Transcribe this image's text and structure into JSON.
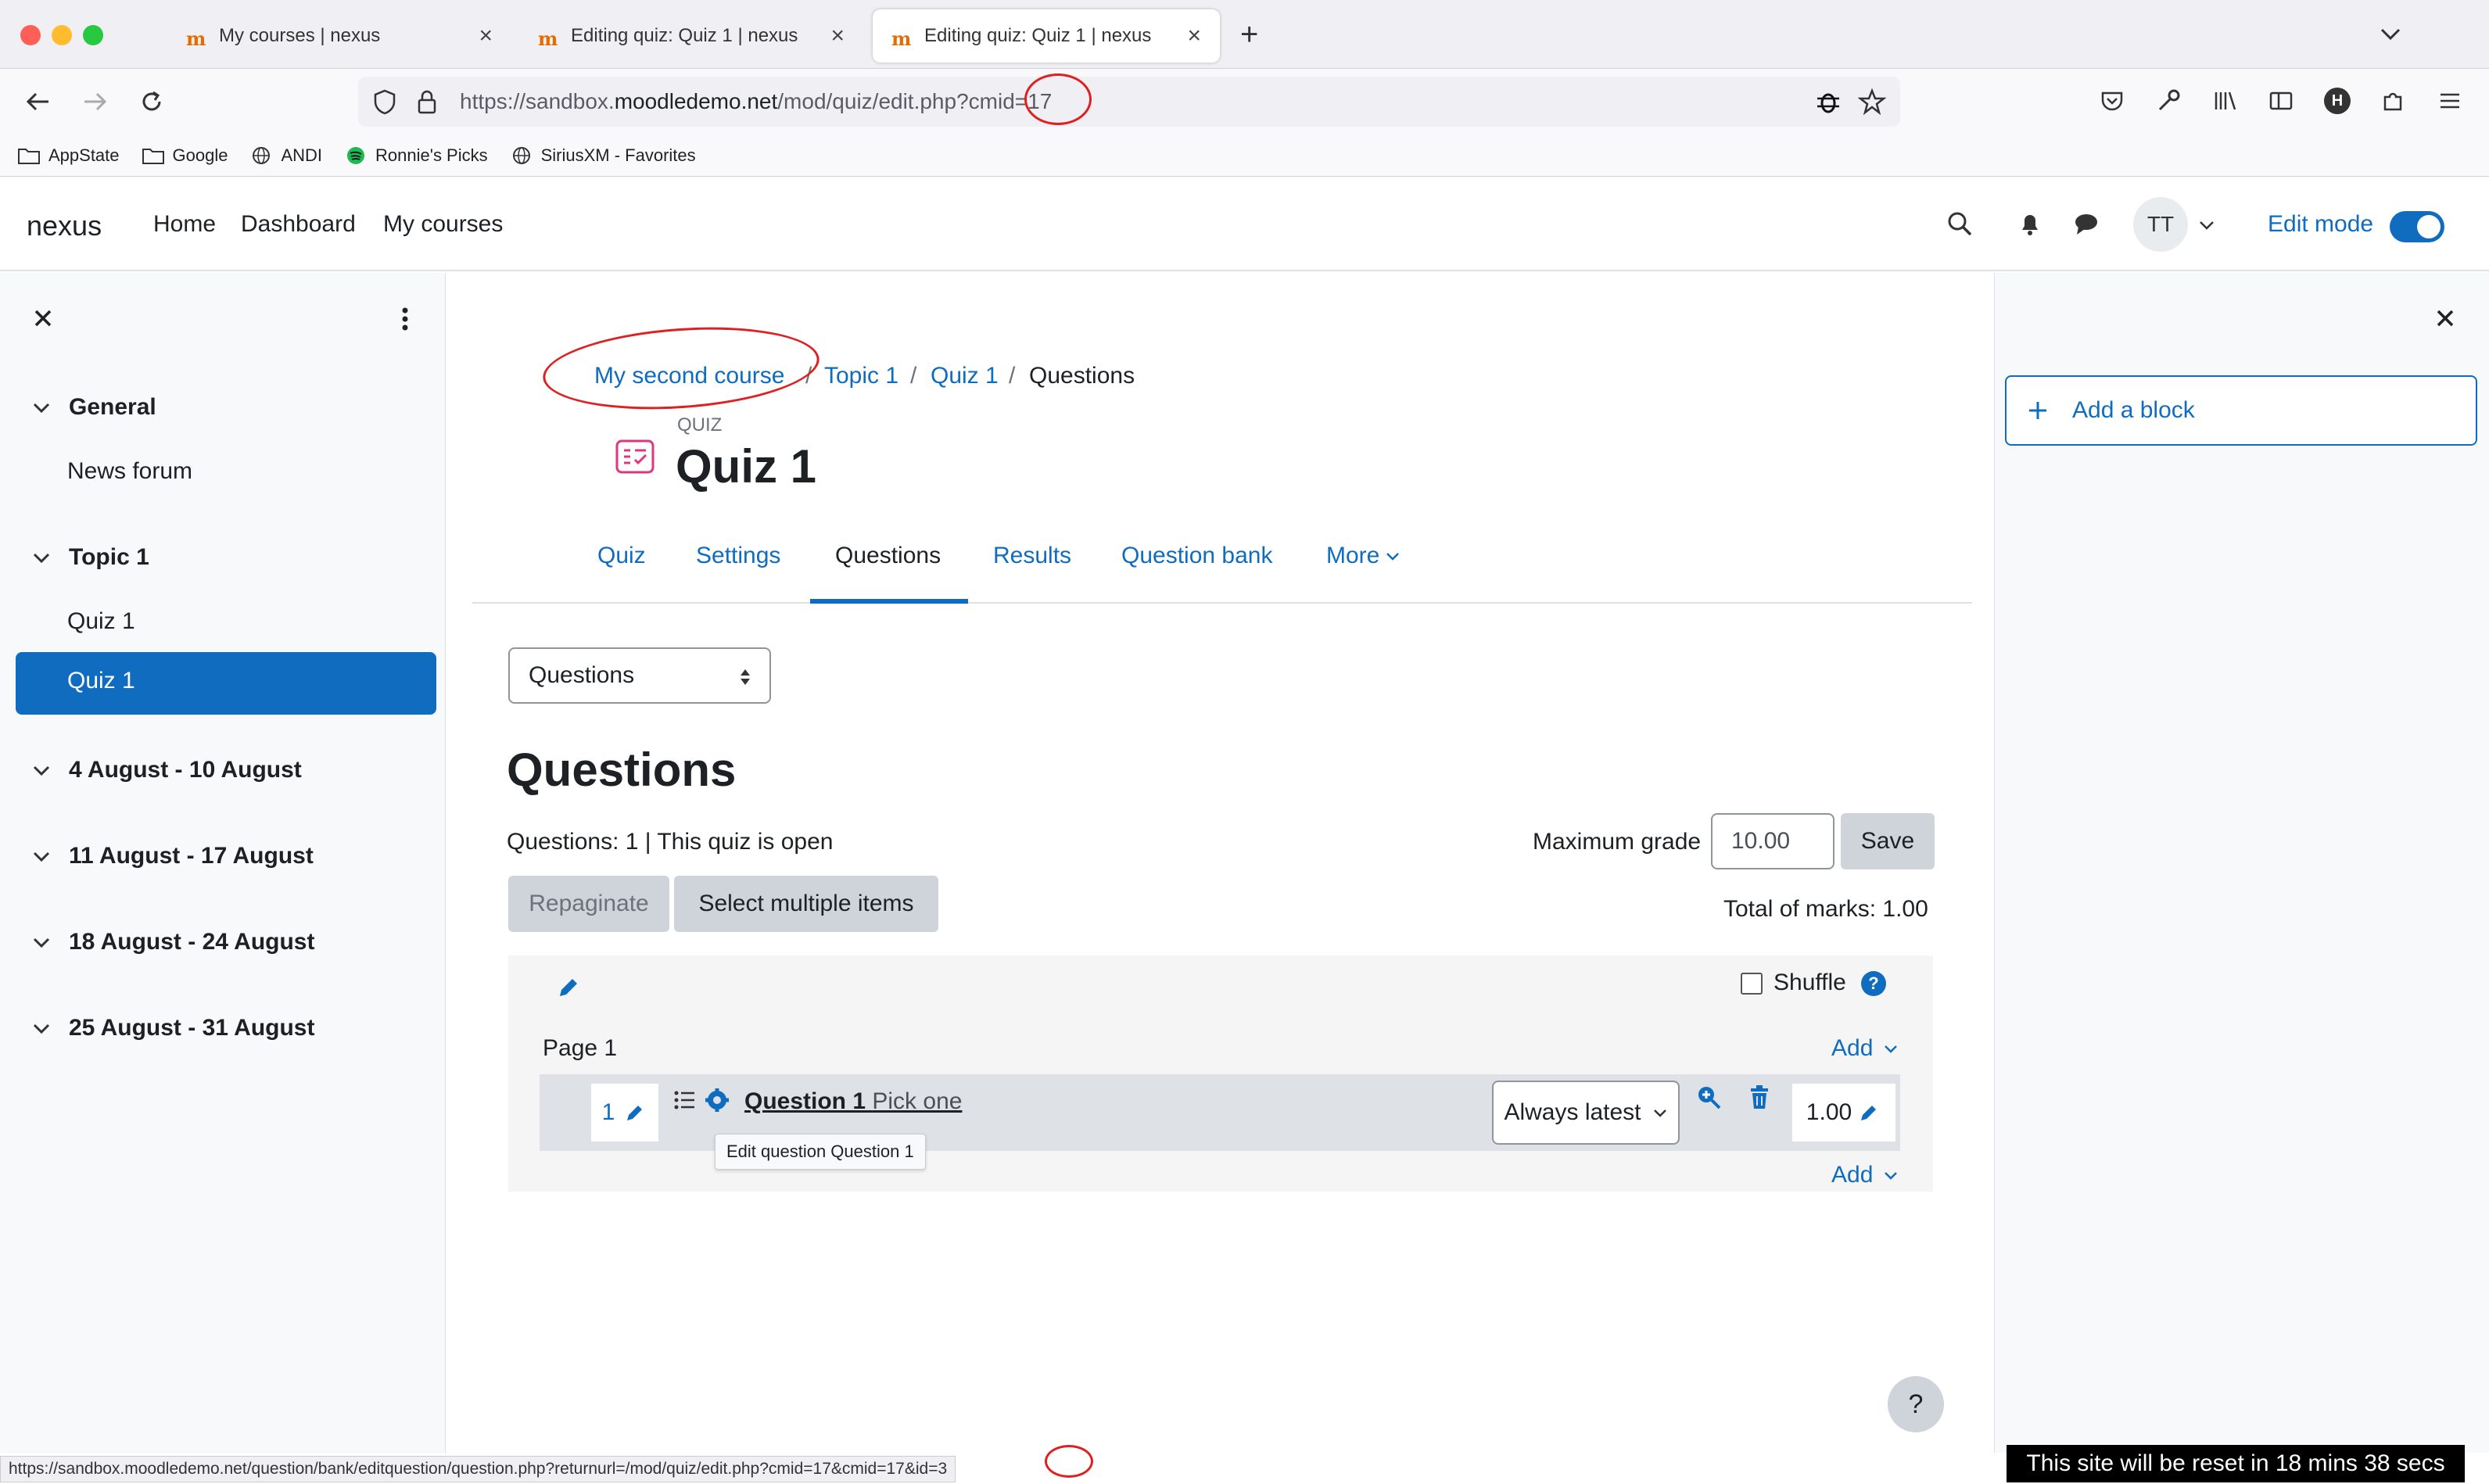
{
  "browser": {
    "tabs": [
      {
        "label": "My courses | nexus",
        "active": false
      },
      {
        "label": "Editing quiz: Quiz 1 | nexus",
        "active": false
      },
      {
        "label": "Editing quiz: Quiz 1 | nexus",
        "active": true
      }
    ],
    "url_prefix": "https://sandbox.",
    "url_host": "moodledemo.net",
    "url_path": "/mod/quiz/edit.php?cmid=17",
    "bookmarks": [
      "AppState",
      "Google",
      "ANDI",
      "Ronnie's Picks",
      "SiriusXM - Favorites"
    ],
    "status_url": "https://sandbox.moodledemo.net/question/bank/editquestion/question.php?returnurl=/mod/quiz/edit.php?cmid=17&cmid=17&id=3"
  },
  "moodle": {
    "brand": "nexus",
    "nav": [
      "Home",
      "Dashboard",
      "My courses"
    ],
    "avatar": "TT",
    "edit_mode": "Edit mode"
  },
  "course_index": {
    "sections": [
      {
        "title": "General",
        "items": [
          "News forum"
        ]
      },
      {
        "title": "Topic 1",
        "items": [
          "Quiz 1",
          "Quiz 1"
        ]
      },
      {
        "title": "4 August - 10 August",
        "items": []
      },
      {
        "title": "11 August - 17 August",
        "items": []
      },
      {
        "title": "18 August - 24 August",
        "items": []
      },
      {
        "title": "25 August - 31 August",
        "items": []
      }
    ]
  },
  "main": {
    "breadcrumb": [
      "My second course",
      "Topic 1",
      "Quiz 1",
      "Questions"
    ],
    "activity_type": "QUIZ",
    "activity_title": "Quiz 1",
    "tabs": [
      "Quiz",
      "Settings",
      "Questions",
      "Results",
      "Question bank",
      "More"
    ],
    "page_select": "Questions",
    "heading": "Questions",
    "info": "Questions: 1 | This quiz is open",
    "max_grade_label": "Maximum grade",
    "max_grade_value": "10.00",
    "save_label": "Save",
    "repaginate_label": "Repaginate",
    "select_multiple_label": "Select multiple items",
    "total_marks": "Total of marks: 1.00",
    "shuffle_label": "Shuffle",
    "page_label": "Page 1",
    "add_label": "Add",
    "question": {
      "number": "1",
      "name": "Question 1",
      "text": "Pick one",
      "version": "Always latest",
      "mark": "1.00",
      "tooltip": "Edit question Question 1"
    }
  },
  "right_drawer": {
    "add_block": "Add a block"
  },
  "help": "?",
  "reset_notice": "This site will be reset in 18 mins 38 secs",
  "colors": {
    "primary": "#0f6cbf",
    "annotation": "#e02020",
    "quiz_icon": "#e0367f"
  }
}
